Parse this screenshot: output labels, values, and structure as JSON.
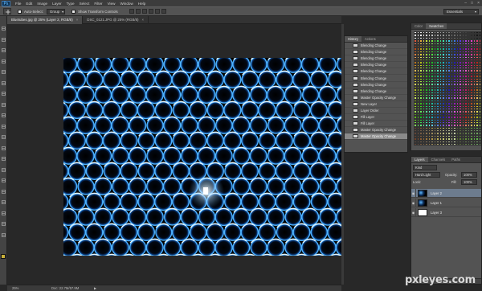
{
  "app": {
    "logo": "Ps"
  },
  "menu": [
    "File",
    "Edit",
    "Image",
    "Layer",
    "Type",
    "Select",
    "Filter",
    "View",
    "Window",
    "Help"
  ],
  "window_controls": [
    "–",
    "□",
    "×"
  ],
  "options_bar": {
    "auto_select_label": "Auto-Select:",
    "auto_select_value": "Group",
    "show_transform_label": "Show Transform Controls",
    "workspace": "Essentials"
  },
  "doc_tabs": [
    {
      "title": "Bluetubes.jpg @ 25% (Layer 2, RGB/8)",
      "active": true
    },
    {
      "title": "DSC_0121.JPG @ 25% (RGB/8)",
      "active": false
    }
  ],
  "status": {
    "zoom": "25%",
    "doc": "Doc: 22.7M/57.9M",
    "arrow": "▶"
  },
  "history": {
    "tabs": [
      "History",
      "Actions"
    ],
    "items": [
      "Blending Change",
      "Blending Change",
      "Blending Change",
      "Blending Change",
      "Blending Change",
      "Blending Change",
      "Blending Change",
      "Blending Change",
      "Master Opacity Change",
      "New Layer",
      "Layer Order",
      "Fill Layer",
      "Fill Layer",
      "Master Opacity Change",
      "Master Opacity Change"
    ],
    "current_index": 14
  },
  "swatches": {
    "tabs": [
      "Color",
      "Swatches"
    ]
  },
  "layers": {
    "tabs": [
      "Layers",
      "Channels",
      "Paths"
    ],
    "kind_label": "Kind",
    "blend_mode": "Hard Light",
    "opacity_label": "Opacity:",
    "opacity_value": "100%",
    "lock_label": "Lock:",
    "fill_label": "Fill:",
    "fill_value": "100%",
    "items": [
      {
        "name": "Layer 2",
        "selected": true,
        "thumb": "photo"
      },
      {
        "name": "Layer 1",
        "selected": false,
        "thumb": "photo"
      },
      {
        "name": "Layer 3",
        "selected": false,
        "thumb": "white"
      }
    ]
  },
  "watermark": "pxleyes.com",
  "colors": {
    "accent": "#2f6fb5",
    "fg_swatch": "#c8b03a",
    "bg_swatch": "#ffffff",
    "tube_glow": "#4fb4ff"
  },
  "tools": [
    "move-icon",
    "marquee-icon",
    "lasso-icon",
    "quick-select-icon",
    "crop-icon",
    "eyedropper-icon",
    "healing-icon",
    "brush-icon",
    "clone-stamp-icon",
    "history-brush-icon",
    "eraser-icon",
    "gradient-icon",
    "blur-icon",
    "dodge-icon",
    "pen-icon",
    "type-icon",
    "path-select-icon",
    "shape-icon",
    "hand-icon",
    "zoom-icon"
  ]
}
